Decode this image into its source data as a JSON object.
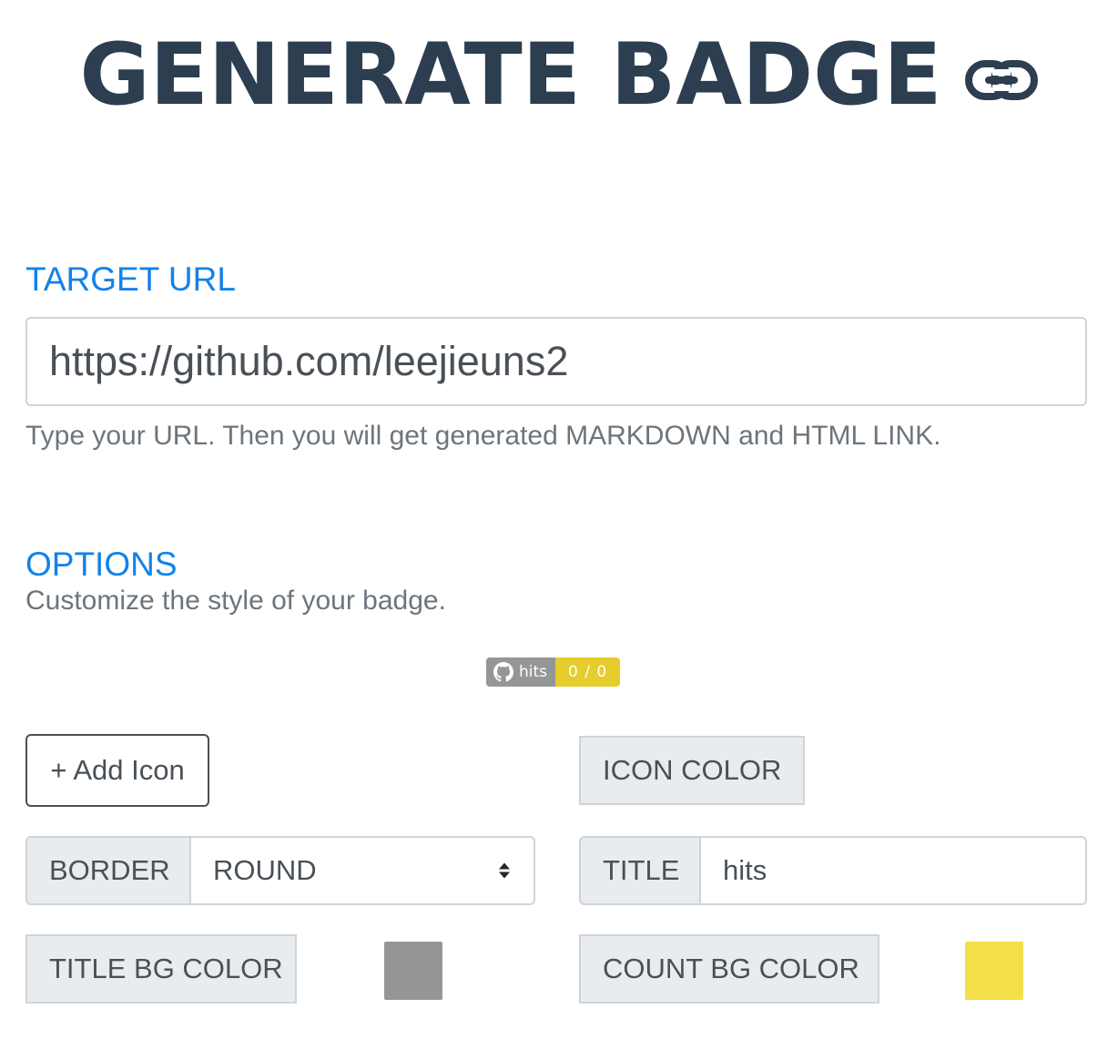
{
  "header": {
    "title": "GENERATE BADGE",
    "icon": "link-icon"
  },
  "target_url": {
    "label": "TARGET URL",
    "value": "https://github.com/leejieuns2",
    "help": "Type your URL. Then you will get generated MARKDOWN and HTML LINK."
  },
  "options": {
    "label": "OPTIONS",
    "help": "Customize the style of your badge."
  },
  "badge": {
    "icon": "github-icon",
    "title": "hits",
    "count": "0 / 0",
    "title_bg": "#959698",
    "count_bg": "#e6cc2c"
  },
  "controls": {
    "add_icon_label": "+ Add Icon",
    "icon_color_label": "ICON COLOR",
    "border_label": "BORDER",
    "border_value": "ROUND",
    "title_label": "TITLE",
    "title_value": "hits",
    "title_bg_label": "TITLE BG COLOR",
    "title_bg_color": "#959698",
    "count_bg_label": "COUNT BG COLOR",
    "count_bg_color": "#f2df4a"
  },
  "colors": {
    "heading": "#2c3e50",
    "accent": "#1382e9",
    "muted": "#6c757d"
  }
}
